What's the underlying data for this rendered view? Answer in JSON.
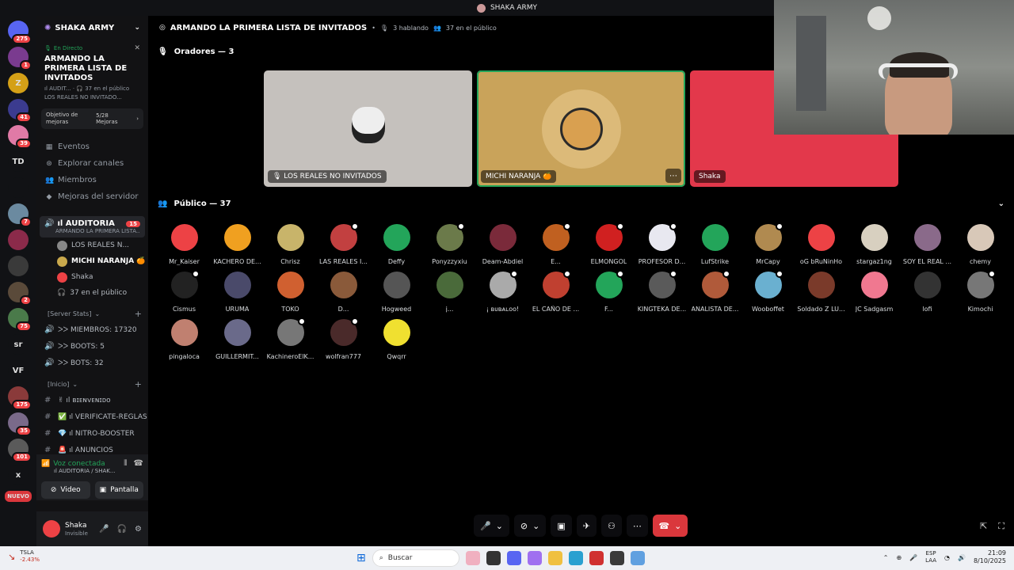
{
  "window_title": "SHAKA ARMY",
  "server_rail": [
    {
      "label": "",
      "badge": "275",
      "color": "#5865f2"
    },
    {
      "label": "",
      "badge": "1",
      "color": "#7a3b8f"
    },
    {
      "label": "Z",
      "badge": "",
      "color": "#d4a017"
    },
    {
      "label": "",
      "badge": "41",
      "color": "#3b3b8f"
    },
    {
      "label": "",
      "badge": "39",
      "color": "#e07aa6"
    },
    {
      "label": "TD",
      "badge": "",
      "color": "#111215"
    },
    {
      "label": "",
      "badge": "",
      "color": "#111215"
    },
    {
      "label": "",
      "badge": "7",
      "color": "#6b8aa0"
    },
    {
      "label": "",
      "badge": "",
      "color": "#8b2a4a"
    },
    {
      "label": "",
      "badge": "",
      "color": "#3a3a3a"
    },
    {
      "label": "",
      "badge": "2",
      "color": "#5a4a3a"
    },
    {
      "label": "",
      "badge": "75",
      "color": "#4a7a4a"
    },
    {
      "label": "sr",
      "badge": "",
      "color": "#111215"
    },
    {
      "label": "VF",
      "badge": "",
      "color": "#111215"
    },
    {
      "label": "",
      "badge": "175",
      "color": "#8a3a3a"
    },
    {
      "label": "",
      "badge": "35",
      "color": "#7a6a8a"
    },
    {
      "label": "",
      "badge": "101",
      "color": "#5a5a5a"
    },
    {
      "label": "x",
      "badge": "",
      "color": "#111215"
    },
    {
      "label": "NUEVO",
      "badge": "",
      "color": "#111215"
    }
  ],
  "server": {
    "name": "SHAKA ARMY"
  },
  "live": {
    "tag": "En Directo",
    "title": "ARMANDO LA PRIMERA LISTA DE INVITADOS",
    "sub1": "ıl AUDIT...  · 🎧 37 en el público",
    "sub2": "LOS REALES NO INVITADO..."
  },
  "goal": {
    "label": "Objetivo de mejoras",
    "progress": "5/28 Mejoras"
  },
  "nav": [
    {
      "icon": "▦",
      "label": "Eventos"
    },
    {
      "icon": "⊛",
      "label": "Explorar canales"
    },
    {
      "icon": "👥",
      "label": "Miembros"
    },
    {
      "icon": "◆",
      "label": "Mejoras del servidor"
    }
  ],
  "voice_channel": {
    "name": "ıl AUDITORIA",
    "badge": "15",
    "sub": "ARMANDO LA PRIMERA LISTA...",
    "members": [
      {
        "name": "LOS REALES N...",
        "color": "#888",
        "bold": false
      },
      {
        "name": "MICHI NARANJA 🍊",
        "color": "#c9a84c",
        "bold": true
      },
      {
        "name": "Shaka",
        "color": "#ed4245",
        "bold": false
      }
    ],
    "audience": "37 en el público"
  },
  "categories": {
    "stats": "[Server Stats]",
    "stats_items": [
      "ᐳᐳ MIEMBROS: 17320",
      "ᐳᐳ BOOTS: 5",
      "ᐳᐳ BOTS: 32"
    ],
    "inicio": "[Inicio]",
    "inicio_items": [
      "✌ ıl ʙɪᴇɴᴠᴇɴɪᴅᴏ",
      "✅ ıl VERIFICATE-REGLAS",
      "💎 ıl NITRO-BOOSTER",
      "🚨 ıl ANUNCIOS"
    ]
  },
  "voice_connected": {
    "status": "Voz conectada",
    "where": "ıl AUDITORIA / SHAK...",
    "video": "Video",
    "screen": "Pantalla"
  },
  "user": {
    "name": "Shaka",
    "status": "Invisible"
  },
  "stage": {
    "title": "ARMANDO LA PRIMERA LISTA DE INVITADOS",
    "speaking": "3 hablando",
    "audience": "37 en el público",
    "speakers_label": "Oradores — 3",
    "public_label": "Público — 37"
  },
  "speakers": [
    {
      "name": "🎙 LOS REALES NO INVITADOS",
      "bg": "#c5c1bd"
    },
    {
      "name": "MICHI NARANJA 🍊",
      "bg": "#c9a35a"
    },
    {
      "name": "Shaka",
      "bg": "#e3384b"
    }
  ],
  "audience": [
    {
      "name": "Mr_Kaiser",
      "color": "#ed4245",
      "stage": false
    },
    {
      "name": "KACHERO DE...",
      "color": "#f0a020",
      "stage": false
    },
    {
      "name": "Chrisz",
      "color": "#c8b46a",
      "stage": false
    },
    {
      "name": "LAS REALES I...",
      "color": "#c24040",
      "stage": true
    },
    {
      "name": "Deffy",
      "color": "#23a55a",
      "stage": false
    },
    {
      "name": "Ponyzzyxiu",
      "color": "#6b7a4a",
      "stage": true
    },
    {
      "name": "Deam-Abdiel",
      "color": "#7a2a3a",
      "stage": false
    },
    {
      "name": "E...",
      "color": "#c06020",
      "stage": true
    },
    {
      "name": "ELMONGOL",
      "color": "#d02020",
      "stage": true
    },
    {
      "name": "PROFESOR D...",
      "color": "#e8e8f0",
      "stage": true
    },
    {
      "name": "LufStrike",
      "color": "#23a55a",
      "stage": false
    },
    {
      "name": "MrCapy",
      "color": "#b08a50",
      "stage": true
    },
    {
      "name": "oG bRuNinHo",
      "color": "#ed4245",
      "stage": false
    },
    {
      "name": "stargaz1ng",
      "color": "#d8d0c0",
      "stage": false
    },
    {
      "name": "SOY EL REAL ...",
      "color": "#8a6a8a",
      "stage": false
    },
    {
      "name": "chemy",
      "color": "#d8c8b8",
      "stage": false
    },
    {
      "name": "Cismus",
      "color": "#222",
      "stage": true
    },
    {
      "name": "URUMA",
      "color": "#4a4a6a",
      "stage": false
    },
    {
      "name": "TOKO",
      "color": "#d06030",
      "stage": false
    },
    {
      "name": "D...",
      "color": "#8a5a3a",
      "stage": false
    },
    {
      "name": "Hogweed",
      "color": "#555",
      "stage": false
    },
    {
      "name": "j...",
      "color": "#4a6a3a",
      "stage": false
    },
    {
      "name": "¡ ʙᴜʙᴀʟᴏᴏ!",
      "color": "#aaa",
      "stage": true
    },
    {
      "name": "EL CAÑO DE ...",
      "color": "#c04030",
      "stage": true
    },
    {
      "name": "F...",
      "color": "#23a55a",
      "stage": true
    },
    {
      "name": "KINGTEKA DE...",
      "color": "#5a5a5a",
      "stage": true
    },
    {
      "name": "ANALISTA DE...",
      "color": "#b05a3a",
      "stage": true
    },
    {
      "name": "Wooboffet",
      "color": "#6ab0d0",
      "stage": true
    },
    {
      "name": "Soldado Z LU...",
      "color": "#7a3a2a",
      "stage": false
    },
    {
      "name": "JC Sadgasm",
      "color": "#f07890",
      "stage": false
    },
    {
      "name": "lofi",
      "color": "#333",
      "stage": false
    },
    {
      "name": "Kimochi",
      "color": "#777",
      "stage": true
    },
    {
      "name": "pingaloca",
      "color": "#c08070",
      "stage": false
    },
    {
      "name": "GUILLERMIT...",
      "color": "#6a6a8a",
      "stage": false
    },
    {
      "name": "KachineroElK...",
      "color": "#777",
      "stage": true
    },
    {
      "name": "wolfran777",
      "color": "#4a2a2a",
      "stage": true
    },
    {
      "name": "Qwqrr",
      "color": "#f0e030",
      "stage": false
    }
  ],
  "taskbar": {
    "ticker": "TSLA",
    "ticker_change": "-2.43%",
    "search": "Buscar",
    "lang1": "ESP",
    "lang2": "LAA",
    "time": "21:09",
    "date": "8/10/2025"
  }
}
